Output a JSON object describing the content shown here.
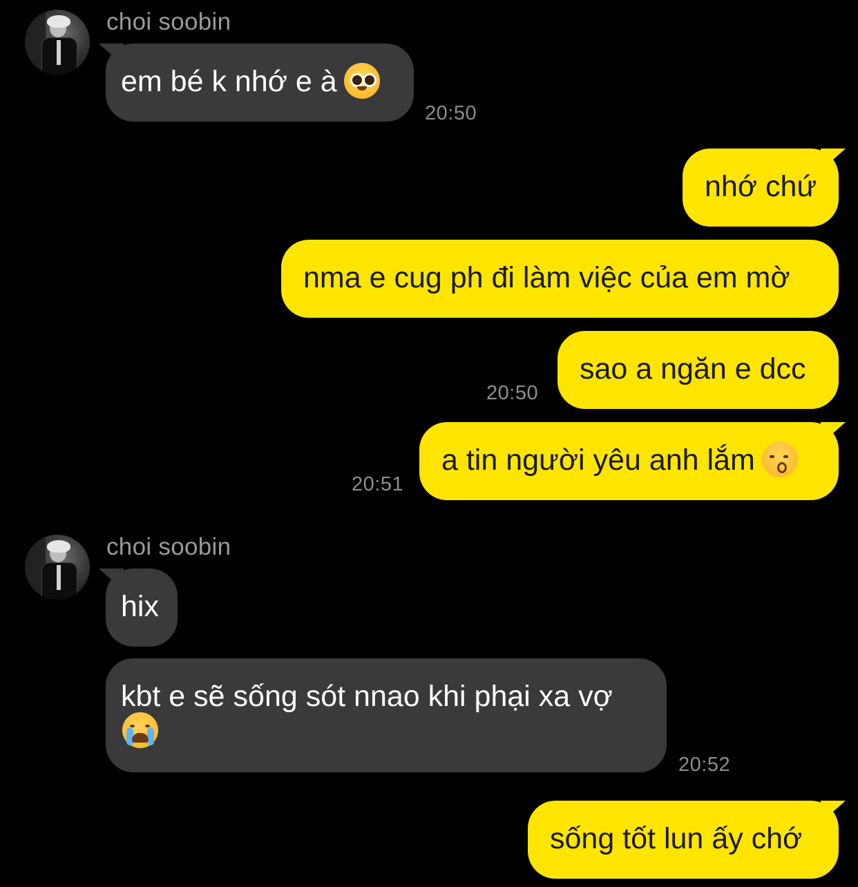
{
  "contact": {
    "name": "choi soobin"
  },
  "messages": [
    {
      "side": "in",
      "text": "em bé k nhớ e à",
      "emoji": "pleading-face-icon",
      "time": "20:50"
    },
    {
      "side": "out",
      "text": "nhớ chứ"
    },
    {
      "side": "out",
      "text": "nma e cug ph đi làm việc của em mờ"
    },
    {
      "side": "out",
      "text": "sao a ngăn e dcc",
      "time": "20:50"
    },
    {
      "side": "out",
      "text": "a tin người yêu anh lắm",
      "emoji": "kissing-face-icon",
      "time": "20:51"
    },
    {
      "side": "in",
      "text": "hix"
    },
    {
      "side": "in",
      "text": "kbt e sẽ sống sót nnao khi phại xa vợ",
      "emoji": "loudly-crying-face-icon",
      "time": "20:52"
    },
    {
      "side": "out",
      "text": "sống tốt lun ấy chớ"
    }
  ],
  "colors": {
    "background": "#000000",
    "incoming_bubble": "#3a3a3c",
    "outgoing_bubble": "#fee500",
    "timestamp": "#8e8e8e"
  }
}
